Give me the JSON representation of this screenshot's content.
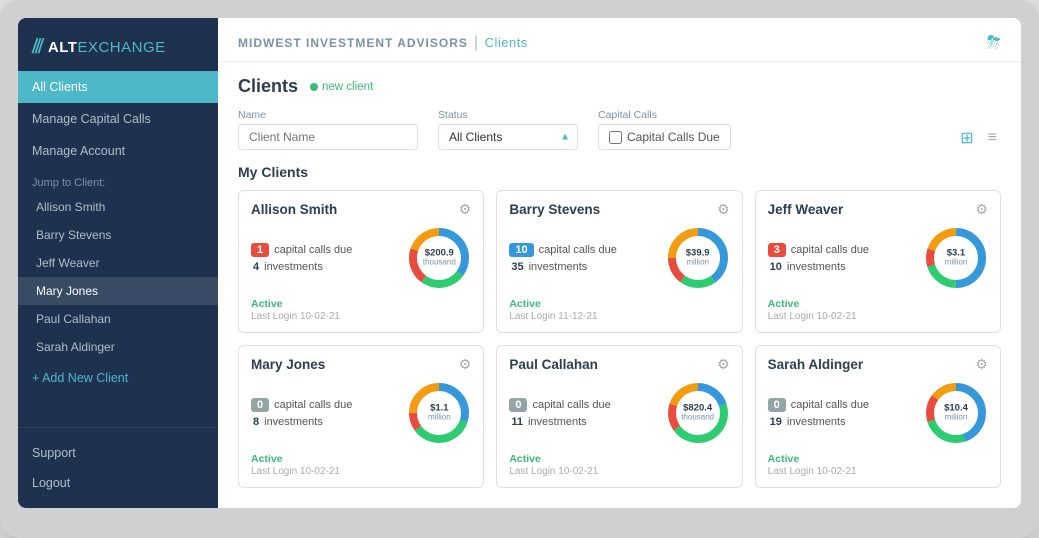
{
  "app": {
    "logo_alt": "ALT",
    "logo_exchange": "EXCHANGE"
  },
  "sidebar": {
    "nav": [
      {
        "label": "All Clients",
        "active": true
      },
      {
        "label": "Manage Capital Calls",
        "active": false
      },
      {
        "label": "Manage Account",
        "active": false
      }
    ],
    "jump_label": "Jump to Client:",
    "jump_items": [
      {
        "label": "Allison Smith"
      },
      {
        "label": "Barry Stevens"
      },
      {
        "label": "Jeff Weaver"
      },
      {
        "label": "Mary Jones",
        "selected": true
      },
      {
        "label": "Paul Callahan"
      },
      {
        "label": "Sarah Aldinger"
      }
    ],
    "add_client": "+ Add New Client",
    "bottom": [
      {
        "label": "Support"
      },
      {
        "label": "Logout"
      }
    ]
  },
  "topbar": {
    "firm": "MIDWEST INVESTMENT ADVISORS",
    "sep": "|",
    "page": "Clients"
  },
  "filters": {
    "name_label": "Name",
    "name_placeholder": "Client Name",
    "status_label": "Status",
    "status_value": "All Clients",
    "capital_calls_label": "Capital Calls",
    "capital_calls_checkbox": "Capital Calls Due"
  },
  "view_toggle": {
    "grid_icon": "⊞",
    "list_icon": "≡"
  },
  "section": {
    "title": "My Clients",
    "new_client_label": "new client"
  },
  "clients_title": "Clients",
  "clients": [
    {
      "name": "Allison Smith",
      "capital_calls_due": 1,
      "investments": 4,
      "badge_type": "red",
      "status": "Active",
      "last_login": "Last Login 10-02-21",
      "chart_value": "$200.9",
      "chart_unit": "thousand",
      "segments": [
        {
          "color": "#3498db",
          "pct": 35
        },
        {
          "color": "#2ecc71",
          "pct": 25
        },
        {
          "color": "#e74c3c",
          "pct": 20
        },
        {
          "color": "#f39c12",
          "pct": 20
        }
      ]
    },
    {
      "name": "Barry Stevens",
      "capital_calls_due": 10,
      "investments": 35,
      "badge_type": "blue",
      "status": "Active",
      "last_login": "Last Login 11-12-21",
      "chart_value": "$39.9",
      "chart_unit": "million",
      "segments": [
        {
          "color": "#3498db",
          "pct": 40
        },
        {
          "color": "#2ecc71",
          "pct": 20
        },
        {
          "color": "#e74c3c",
          "pct": 15
        },
        {
          "color": "#f39c12",
          "pct": 25
        }
      ]
    },
    {
      "name": "Jeff Weaver",
      "capital_calls_due": 3,
      "investments": 10,
      "badge_type": "red",
      "status": "Active",
      "last_login": "Last Login 10-02-21",
      "chart_value": "$3.1",
      "chart_unit": "million",
      "segments": [
        {
          "color": "#3498db",
          "pct": 50
        },
        {
          "color": "#2ecc71",
          "pct": 20
        },
        {
          "color": "#e74c3c",
          "pct": 10
        },
        {
          "color": "#f39c12",
          "pct": 20
        }
      ]
    },
    {
      "name": "Mary Jones",
      "capital_calls_due": 0,
      "investments": 8,
      "badge_type": "gray",
      "status": "Active",
      "last_login": "Last Login 10-02-21",
      "chart_value": "$1.1",
      "chart_unit": "million",
      "segments": [
        {
          "color": "#3498db",
          "pct": 30
        },
        {
          "color": "#2ecc71",
          "pct": 35
        },
        {
          "color": "#e74c3c",
          "pct": 10
        },
        {
          "color": "#f39c12",
          "pct": 25
        }
      ]
    },
    {
      "name": "Paul Callahan",
      "capital_calls_due": 0,
      "investments": 11,
      "badge_type": "gray",
      "status": "Active",
      "last_login": "Last Login 10-02-21",
      "chart_value": "$820.4",
      "chart_unit": "thousand",
      "segments": [
        {
          "color": "#3498db",
          "pct": 20
        },
        {
          "color": "#2ecc71",
          "pct": 45
        },
        {
          "color": "#e74c3c",
          "pct": 15
        },
        {
          "color": "#f39c12",
          "pct": 20
        }
      ]
    },
    {
      "name": "Sarah Aldinger",
      "capital_calls_due": 0,
      "investments": 19,
      "badge_type": "gray",
      "status": "Active",
      "last_login": "Last Login 10-02-21",
      "chart_value": "$10.4",
      "chart_unit": "million",
      "segments": [
        {
          "color": "#3498db",
          "pct": 45
        },
        {
          "color": "#2ecc71",
          "pct": 25
        },
        {
          "color": "#e74c3c",
          "pct": 15
        },
        {
          "color": "#f39c12",
          "pct": 15
        }
      ]
    }
  ]
}
